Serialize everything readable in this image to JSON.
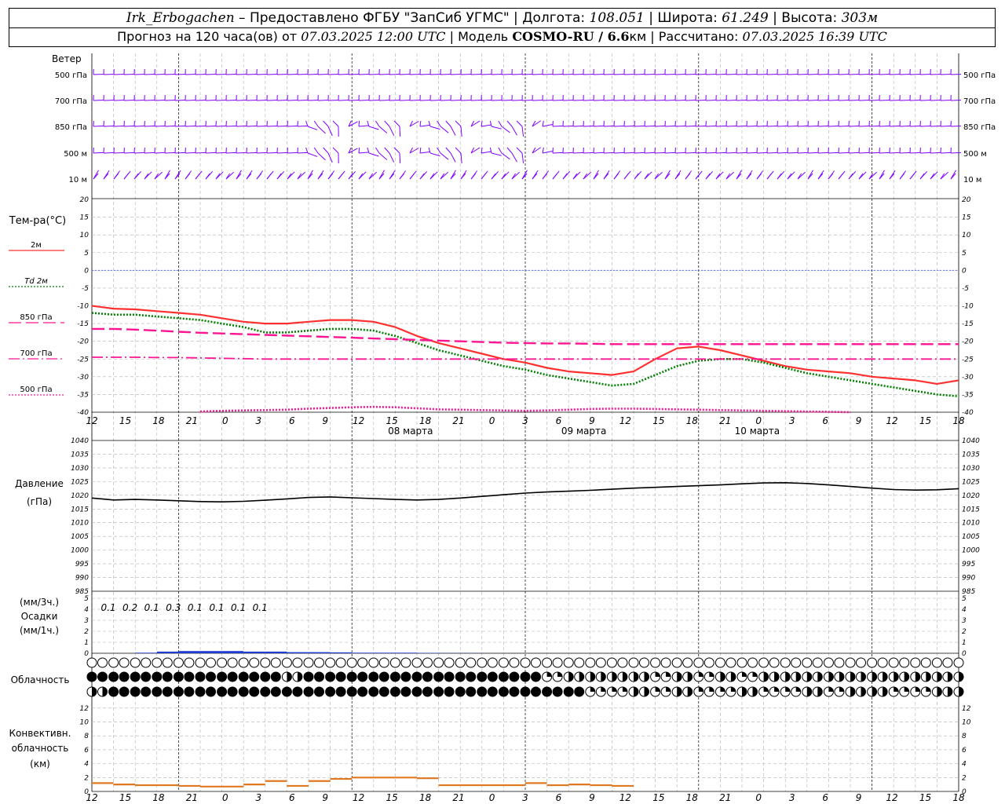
{
  "header": {
    "station": "Irk_Erbogachen",
    "provider": "– Предоставлено ФГБУ \"ЗапСиб УГМС\"",
    "lon_label": "Долгота:",
    "lon": "108.051",
    "lat_label": "Широта:",
    "lat": "61.249",
    "alt_label": "Высота:",
    "alt": "303м",
    "forecast_prefix": "Прогноз на 120 часа(ов) от",
    "forecast_start": "07.03.2025 12:00 UTC",
    "model_label": "Модель",
    "model": "COSMO-RU / 6.6",
    "model_unit": "км",
    "calc_label": "Рассчитано:",
    "calc_time": "07.03.2025 16:39 UTC"
  },
  "labels": {
    "wind": "Ветер",
    "wind_levels": [
      "500 гПа",
      "700 гПа",
      "850 гПа",
      "500 м",
      "10 м"
    ],
    "temp_title": "Тем-ра(°С)",
    "temp_legend": [
      {
        "name": "2м",
        "color": "#ff3030",
        "style": "solid"
      },
      {
        "name": "Td 2м",
        "color": "#008000",
        "style": "dotted"
      },
      {
        "name": "850 гПа",
        "color": "#ff1493",
        "style": "longdash"
      },
      {
        "name": "700 гПа",
        "color": "#ff1493",
        "style": "dashdot"
      },
      {
        "name": "500 гПа",
        "color": "#ff1493",
        "style": "dot"
      }
    ],
    "pressure": "Давление",
    "pressure_unit": "(гПа)",
    "precip_unit3": "(мм/3ч.)",
    "precip": "Осадки",
    "precip_unit1": "(мм/1ч.)",
    "cloud": "Облачность",
    "conv1": "Конвективн.",
    "conv2": "облачность",
    "conv3": "(км)"
  },
  "colors": {
    "t2m": "#ff3030",
    "td2m": "#008000",
    "upper": "#ff1493",
    "wind": "#8000ff",
    "precip": "#1e3cd2",
    "conv": "#e07820",
    "zero_line": "#4060ff"
  },
  "chart_data": [
    {
      "type": "line",
      "title": "Тем-ра(°С)",
      "x_hours": [
        0,
        3,
        6,
        9,
        12,
        15,
        18,
        21,
        24,
        27,
        30,
        33,
        36,
        39,
        42,
        45,
        48,
        51,
        54,
        57,
        60,
        63,
        66,
        69,
        72,
        75,
        78,
        81,
        84,
        87,
        90,
        93,
        96,
        99,
        102,
        105,
        108,
        111,
        114,
        117,
        120
      ],
      "x_ticks": [
        "12",
        "15",
        "18",
        "21",
        "0",
        "3",
        "6",
        "9",
        "12",
        "15",
        "18",
        "21",
        "0",
        "3",
        "6",
        "9",
        "12",
        "15",
        "18",
        "21",
        "0",
        "3",
        "6",
        "9",
        "12",
        "15",
        "18"
      ],
      "day_labels": [
        {
          "hour": 24,
          "text": "08 марта"
        },
        {
          "hour": 48,
          "text": "09 марта"
        },
        {
          "hour": 72,
          "text": "10 марта"
        }
      ],
      "ylim": [
        -40,
        20
      ],
      "yticks": [
        -40,
        -35,
        -30,
        -25,
        -20,
        -15,
        -10,
        -5,
        0,
        5,
        10,
        15,
        20
      ],
      "series": [
        {
          "name": "2м",
          "values": [
            -10,
            -10.8,
            -11,
            -11.5,
            -12,
            -12.5,
            -13.5,
            -14.5,
            -15,
            -15,
            -14.5,
            -14,
            -14,
            -14.5,
            -16,
            -18.5,
            -20.5,
            -22,
            -23.5,
            -25,
            -26,
            -27.5,
            -28.5,
            -29,
            -29.5,
            -28.5,
            -25,
            -22,
            -21.5,
            -22.5,
            -24,
            -25.5,
            -27,
            -28,
            -28.5,
            -29,
            -30,
            -30.5,
            -31,
            -32,
            -31
          ]
        },
        {
          "name": "Td 2м",
          "values": [
            -12,
            -12.5,
            -12.5,
            -13,
            -13.5,
            -14,
            -15,
            -16,
            -17.5,
            -17.5,
            -17,
            -16.5,
            -16.5,
            -17,
            -18.5,
            -20.5,
            -22.5,
            -24,
            -25.5,
            -27,
            -28,
            -29.5,
            -30.5,
            -31.5,
            -32.5,
            -32,
            -29.5,
            -27,
            -25.5,
            -25,
            -25,
            -26,
            -27.5,
            -29,
            -30,
            -31,
            -32,
            -33,
            -34,
            -35,
            -35.5
          ]
        },
        {
          "name": "850 гПа",
          "values": [
            -16.5,
            -16.5,
            -16.7,
            -17,
            -17.3,
            -17.6,
            -17.8,
            -18,
            -18.2,
            -18.4,
            -18.6,
            -18.8,
            -19,
            -19.2,
            -19.4,
            -19.6,
            -19.8,
            -20,
            -20.2,
            -20.4,
            -20.5,
            -20.6,
            -20.6,
            -20.7,
            -20.8,
            -20.8,
            -20.8,
            -20.8,
            -20.8,
            -20.8,
            -20.8,
            -20.8,
            -20.8,
            -20.8,
            -20.8,
            -20.8,
            -20.8,
            -20.8,
            -20.8,
            -20.8,
            -20.8
          ]
        },
        {
          "name": "700 гПа",
          "values": [
            -24.5,
            -24.5,
            -24.5,
            -24.6,
            -24.6,
            -24.7,
            -24.8,
            -24.9,
            -25,
            -25,
            -25,
            -25,
            -25,
            -25,
            -25,
            -25,
            -25,
            -25,
            -25,
            -25,
            -25,
            -25,
            -25,
            -25,
            -25,
            -25,
            -25,
            -25,
            -25,
            -25,
            -25,
            -25,
            -25,
            -25,
            -25,
            -25,
            -25,
            -25,
            -25,
            -25,
            -25
          ]
        },
        {
          "name": "500 гПа",
          "values": [
            null,
            null,
            null,
            null,
            null,
            -39.8,
            -39.6,
            -39.5,
            -39.4,
            -39.3,
            -39,
            -38.8,
            -38.6,
            -38.5,
            -38.6,
            -38.9,
            -39.2,
            -39.3,
            -39.4,
            -39.5,
            -39.6,
            -39.5,
            -39.3,
            -39.1,
            -39,
            -39,
            -39.1,
            -39.2,
            -39.3,
            -39.4,
            -39.5,
            -39.6,
            -39.7,
            -39.8,
            -39.9,
            -40,
            null,
            null,
            null,
            null,
            null
          ]
        }
      ]
    },
    {
      "type": "line",
      "title": "Давление",
      "ylabel": "(гПа)",
      "ylim": [
        985,
        1040
      ],
      "yticks": [
        985,
        990,
        995,
        1000,
        1005,
        1010,
        1015,
        1020,
        1025,
        1030,
        1035,
        1040
      ],
      "series": [
        {
          "name": "Давление",
          "values": [
            1019,
            1018.3,
            1018.5,
            1018.3,
            1018,
            1017.7,
            1017.6,
            1017.8,
            1018.2,
            1018.7,
            1019.2,
            1019.4,
            1019.1,
            1018.8,
            1018.5,
            1018.3,
            1018.5,
            1019,
            1019.6,
            1020.2,
            1020.8,
            1021.2,
            1021.5,
            1021.8,
            1022.2,
            1022.6,
            1022.9,
            1023.2,
            1023.5,
            1023.8,
            1024.2,
            1024.5,
            1024.6,
            1024.3,
            1023.8,
            1023.2,
            1022.6,
            1022.1,
            1021.9,
            1022,
            1022.4
          ]
        }
      ]
    },
    {
      "type": "bar",
      "title": "Осадки",
      "ylim": [
        0,
        5
      ],
      "yticks": [
        0,
        1,
        2,
        3,
        4,
        5
      ],
      "sum_labels": [
        "0.1",
        "0.2",
        "0.1",
        "0.3",
        "0.1",
        "0.1",
        "0.1",
        "0.1"
      ],
      "series": [
        {
          "name": "Осадки",
          "values": [
            0,
            0,
            0.05,
            0.15,
            0.2,
            0.2,
            0.2,
            0.15,
            0.15,
            0.1,
            0.1,
            0.08,
            0.05,
            0.05,
            0.05,
            0.03,
            0.02,
            0.02,
            0,
            0,
            0,
            0,
            0,
            0,
            0,
            0,
            0,
            0,
            0,
            0,
            0,
            0,
            0,
            0,
            0,
            0,
            0,
            0,
            0,
            0,
            0
          ]
        }
      ]
    },
    {
      "type": "line",
      "title": "Конвективн. облачность",
      "ylabel": "(км)",
      "ylim": [
        0,
        13
      ],
      "yticks": [
        0,
        2,
        4,
        6,
        8,
        10,
        12
      ],
      "series": [
        {
          "name": "Конвективн. облачность",
          "values": [
            1.2,
            1,
            0.9,
            0.9,
            0.8,
            0.7,
            0.7,
            1,
            1.5,
            0.8,
            1.5,
            1.8,
            2,
            2,
            2,
            1.9,
            0.9,
            0.9,
            0.9,
            0.9,
            1.2,
            0.9,
            1,
            0.9,
            0.8,
            null,
            null,
            null,
            null,
            null,
            null,
            null,
            null,
            null,
            null,
            null,
            null,
            null,
            null,
            null,
            null
          ]
        }
      ]
    }
  ],
  "cloud_rows": [
    [
      "o",
      "o",
      "o",
      "o",
      "o",
      "o",
      "o",
      "o",
      "o",
      "o",
      "o",
      "o",
      "o",
      "o",
      "o",
      "o",
      "o",
      "o",
      "o",
      "o",
      "o",
      "o",
      "o",
      "o",
      "o",
      "o",
      "o",
      "o",
      "o",
      "o",
      "o",
      "o",
      "o",
      "o",
      "o",
      "o",
      "o",
      "o",
      "o",
      "o",
      "o"
    ],
    [
      "f",
      "f",
      "f",
      "f",
      "f",
      "f",
      "f",
      "f",
      "f",
      "h",
      "f",
      "f",
      "f",
      "f",
      "f",
      "f",
      "f",
      "f",
      "f",
      "f",
      "f",
      "q",
      "h",
      "h",
      "h",
      "h",
      "q",
      "h",
      "q",
      "h",
      "q",
      "h",
      "h",
      "h",
      "h",
      "h",
      "h",
      "h",
      "h",
      "h",
      "h"
    ],
    [
      "h",
      "f",
      "f",
      "f",
      "f",
      "f",
      "f",
      "f",
      "f",
      "f",
      "f",
      "f",
      "f",
      "f",
      "f",
      "f",
      "f",
      "f",
      "f",
      "f",
      "f",
      "f",
      "f",
      "q",
      "q",
      "h",
      "q",
      "h",
      "q",
      "q",
      "h",
      "q",
      "q",
      "h",
      "q",
      "h",
      "h",
      "q",
      "q",
      "h",
      "h"
    ]
  ]
}
